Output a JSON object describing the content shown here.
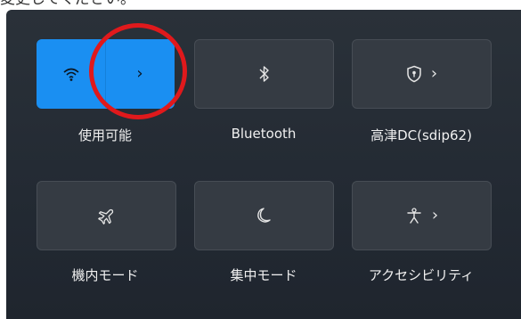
{
  "caption": "変更してください。",
  "tiles": [
    {
      "label": "使用可能",
      "icon": "wifi-icon",
      "active": true
    },
    {
      "label": "Bluetooth",
      "icon": "bluetooth-icon"
    },
    {
      "label": "高津DC(sdip62)",
      "icon": "vpn-shield-icon"
    },
    {
      "label": "機内モード",
      "icon": "airplane-icon"
    },
    {
      "label": "集中モード",
      "icon": "focus-moon-icon"
    },
    {
      "label": "アクセシビリティ",
      "icon": "accessibility-icon"
    }
  ],
  "chevron": "›",
  "colors": {
    "accent": "#1a8ff2",
    "highlight": "#e0191c",
    "panel": "#252b33"
  }
}
